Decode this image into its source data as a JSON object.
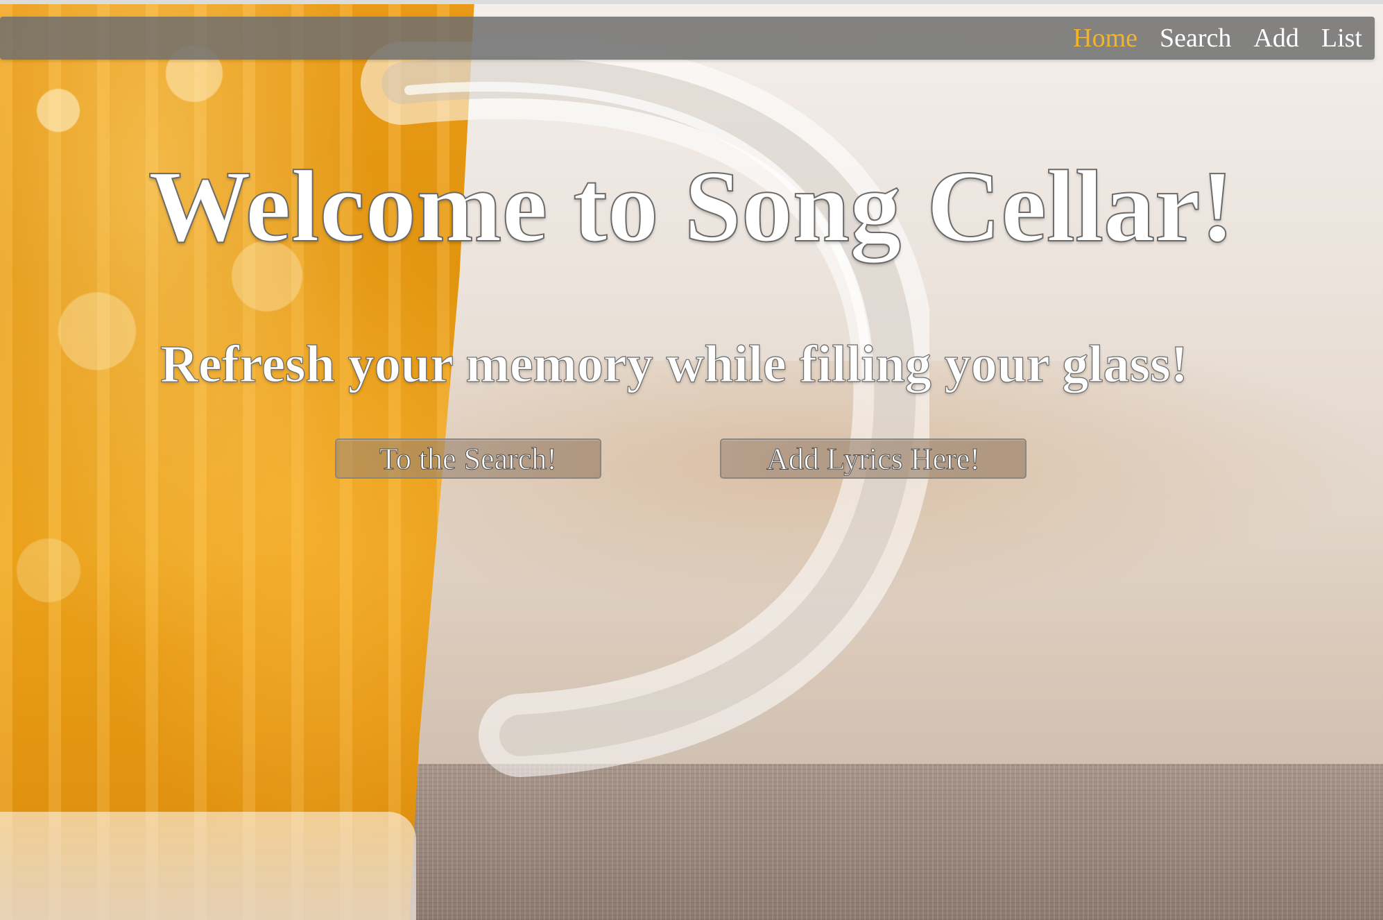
{
  "nav": {
    "items": [
      {
        "label": "Home",
        "active": true
      },
      {
        "label": "Search",
        "active": false
      },
      {
        "label": "Add",
        "active": false
      },
      {
        "label": "List",
        "active": false
      }
    ],
    "active_color": "#f5b326"
  },
  "hero": {
    "title": "Welcome to Song Cellar!",
    "subtitle": "Refresh your memory while filling your glass!"
  },
  "buttons": {
    "search_label": "To the Search!",
    "add_label": "Add Lyrics Here!"
  },
  "background": {
    "icon": "beer-mug-photo",
    "accent_color": "#f0a21a"
  }
}
